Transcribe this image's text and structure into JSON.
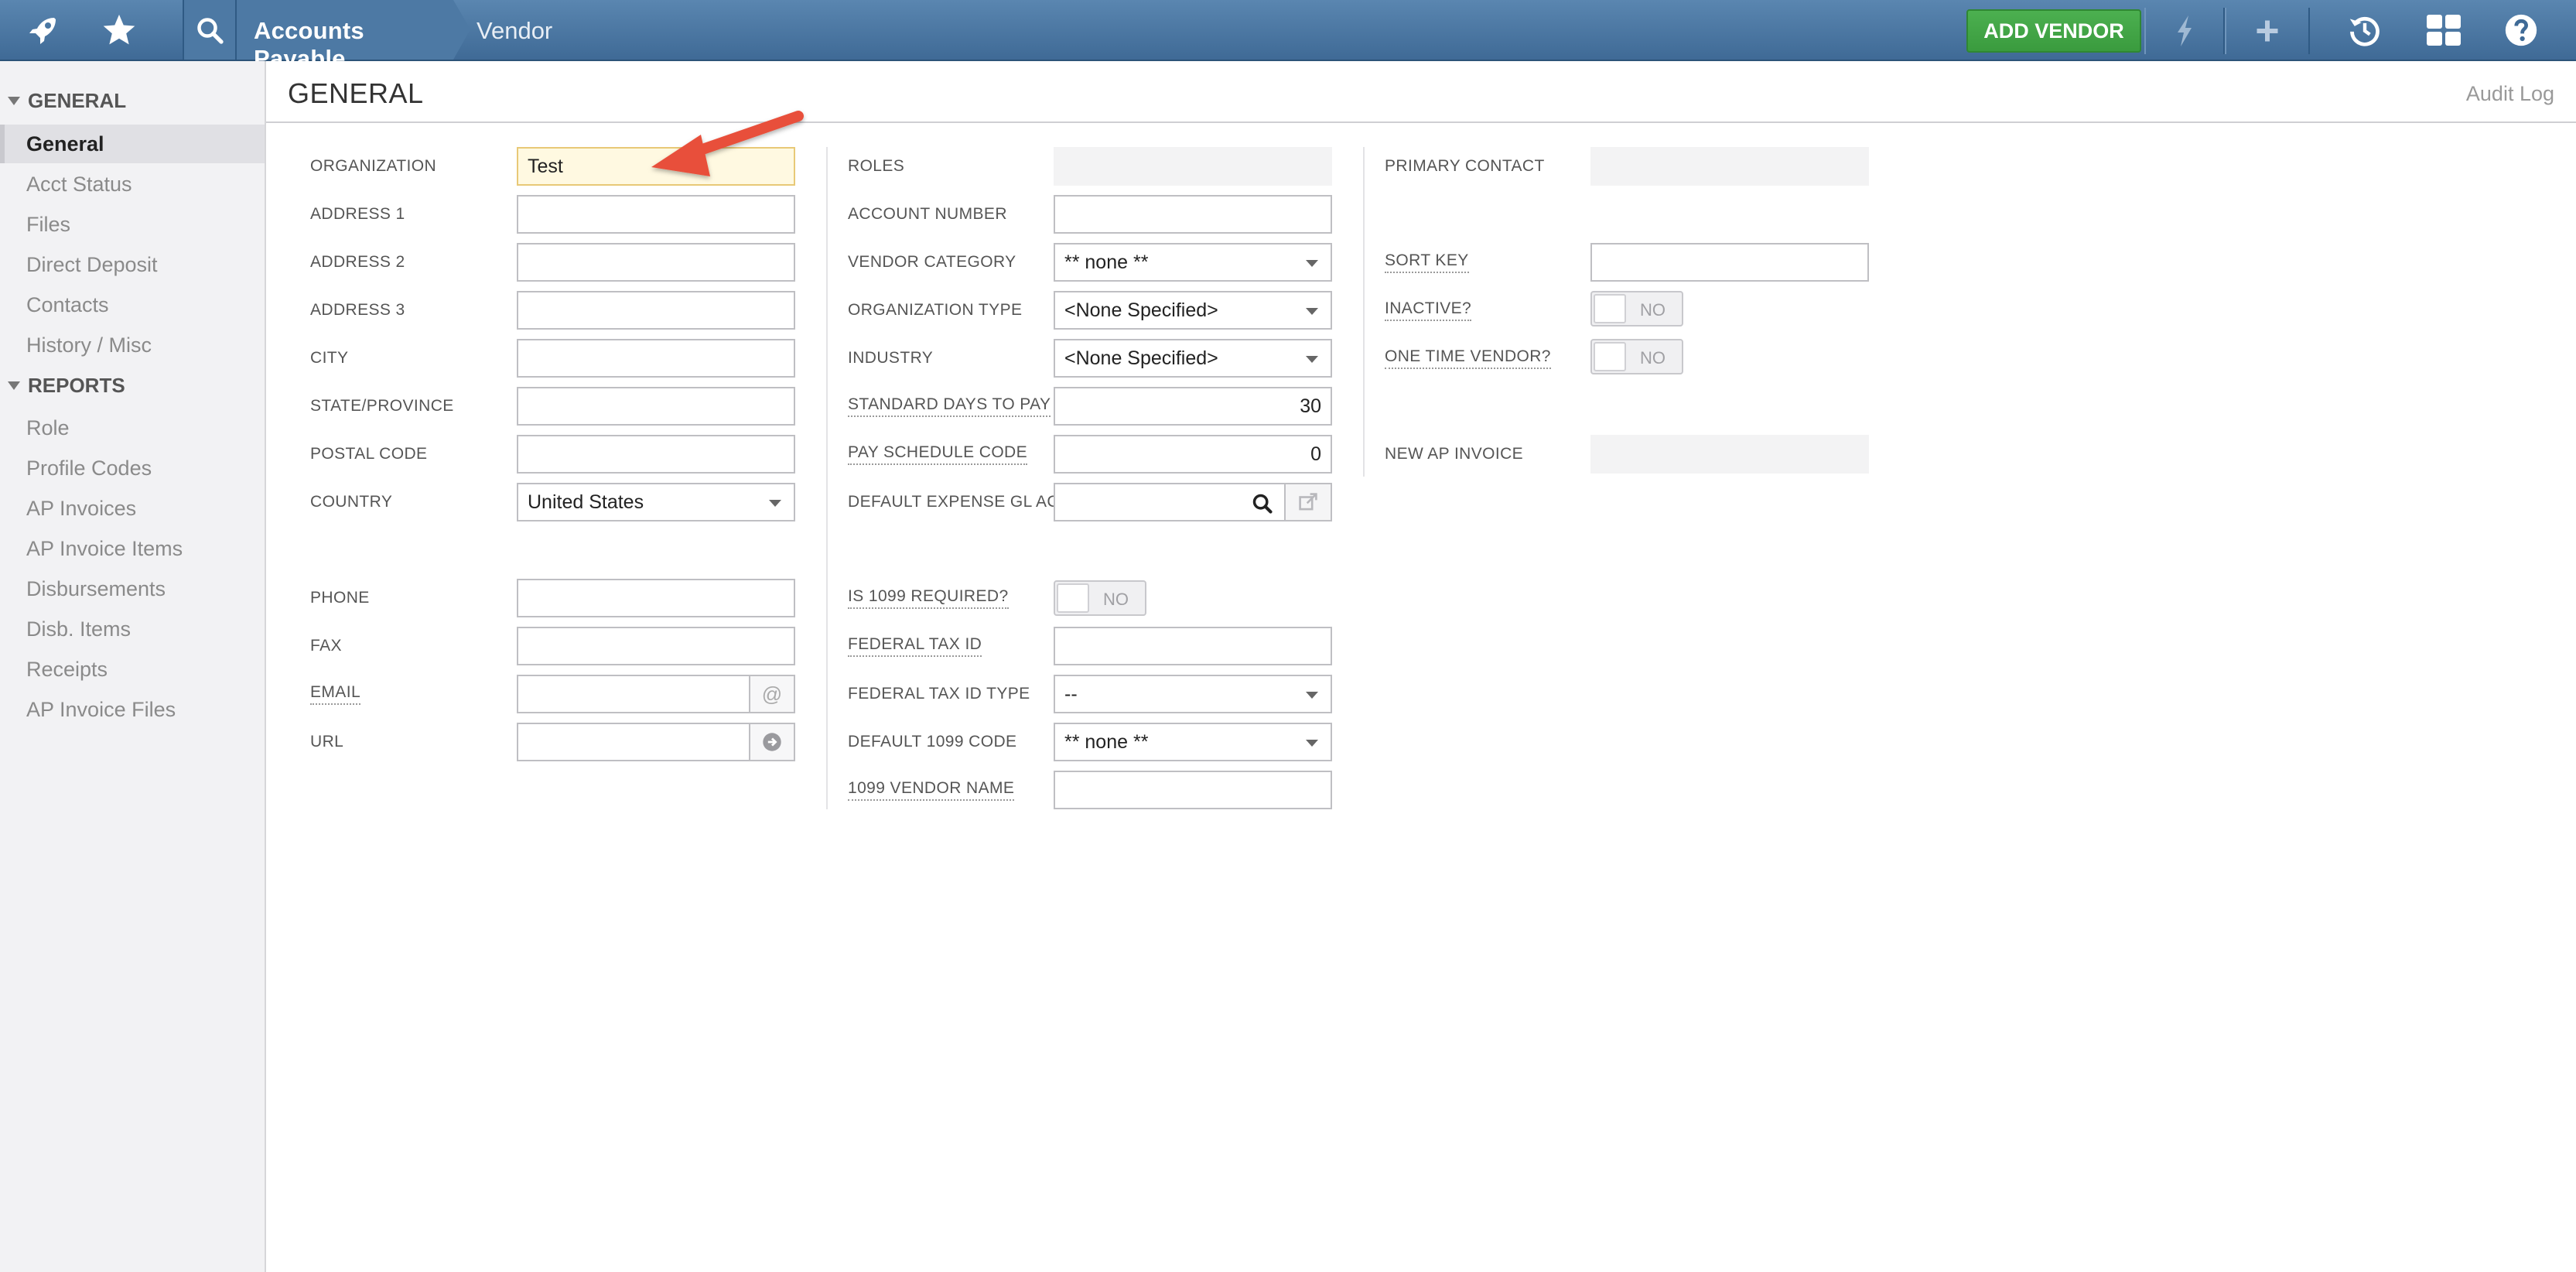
{
  "header": {
    "breadcrumb_module": "Accounts Payable",
    "breadcrumb_page": "Vendor",
    "add_vendor_label": "ADD VENDOR"
  },
  "sidebar": {
    "general_heading": "GENERAL",
    "general_items": [
      {
        "label": "General"
      },
      {
        "label": "Acct Status"
      },
      {
        "label": "Files"
      },
      {
        "label": "Direct Deposit"
      },
      {
        "label": "Contacts"
      },
      {
        "label": "History / Misc"
      }
    ],
    "reports_heading": "REPORTS",
    "report_items": [
      {
        "label": "Role"
      },
      {
        "label": "Profile Codes"
      },
      {
        "label": "AP Invoices"
      },
      {
        "label": "AP Invoice Items"
      },
      {
        "label": "Disbursements"
      },
      {
        "label": "Disb. Items"
      },
      {
        "label": "Receipts"
      },
      {
        "label": "AP Invoice Files"
      }
    ]
  },
  "main": {
    "title": "GENERAL",
    "audit_log": "Audit Log"
  },
  "form": {
    "col1": {
      "organization": {
        "label": "ORGANIZATION",
        "value": "Test"
      },
      "address1": {
        "label": "ADDRESS 1",
        "value": ""
      },
      "address2": {
        "label": "ADDRESS 2",
        "value": ""
      },
      "address3": {
        "label": "ADDRESS 3",
        "value": ""
      },
      "city": {
        "label": "CITY",
        "value": ""
      },
      "state": {
        "label": "STATE/PROVINCE",
        "value": ""
      },
      "postal": {
        "label": "POSTAL CODE",
        "value": ""
      },
      "country": {
        "label": "COUNTRY",
        "value": "United States"
      },
      "phone": {
        "label": "PHONE",
        "value": ""
      },
      "fax": {
        "label": "FAX",
        "value": ""
      },
      "email": {
        "label": "EMAIL",
        "value": ""
      },
      "url": {
        "label": "URL",
        "value": ""
      }
    },
    "col2": {
      "roles": {
        "label": "ROLES",
        "value": ""
      },
      "account_number": {
        "label": "ACCOUNT NUMBER",
        "value": ""
      },
      "vendor_category": {
        "label": "VENDOR CATEGORY",
        "value": "** none **"
      },
      "org_type": {
        "label": "ORGANIZATION TYPE",
        "value": "<None Specified>"
      },
      "industry": {
        "label": "INDUSTRY",
        "value": "<None Specified>"
      },
      "std_days": {
        "label": "STANDARD DAYS TO PAY",
        "value": "30"
      },
      "pay_schedule": {
        "label": "PAY SCHEDULE CODE",
        "value": "0"
      },
      "default_gl": {
        "label": "DEFAULT EXPENSE GL ACCT",
        "value": ""
      },
      "is_1099": {
        "label": "IS 1099 REQUIRED?",
        "value": "NO"
      },
      "federal_tax_id": {
        "label": "FEDERAL TAX ID",
        "value": ""
      },
      "federal_tax_id_type": {
        "label": "FEDERAL TAX ID TYPE",
        "value": "--"
      },
      "default_1099": {
        "label": "DEFAULT 1099 CODE",
        "value": "** none **"
      },
      "vendor_name_1099": {
        "label": "1099 VENDOR NAME",
        "value": ""
      }
    },
    "col3": {
      "primary_contact": {
        "label": "PRIMARY CONTACT",
        "value": ""
      },
      "sort_key": {
        "label": "SORT KEY",
        "value": ""
      },
      "inactive": {
        "label": "INACTIVE?",
        "value": "NO"
      },
      "one_time_vendor": {
        "label": "ONE TIME VENDOR?",
        "value": "NO"
      },
      "new_ap_invoice": {
        "label": "NEW AP INVOICE",
        "value": ""
      }
    }
  },
  "colors": {
    "topbar": "#4a77a3",
    "add_vendor": "#43a447",
    "highlight_field": "#fff9e1",
    "annotation_arrow": "#e8503a"
  },
  "icons": [
    "rocket-icon",
    "star-icon",
    "search-icon",
    "bolt-icon",
    "plus-icon",
    "history-icon",
    "grid-icon",
    "help-icon",
    "magnifier-icon",
    "external-link-icon",
    "at-icon",
    "arrow-circle-icon"
  ]
}
